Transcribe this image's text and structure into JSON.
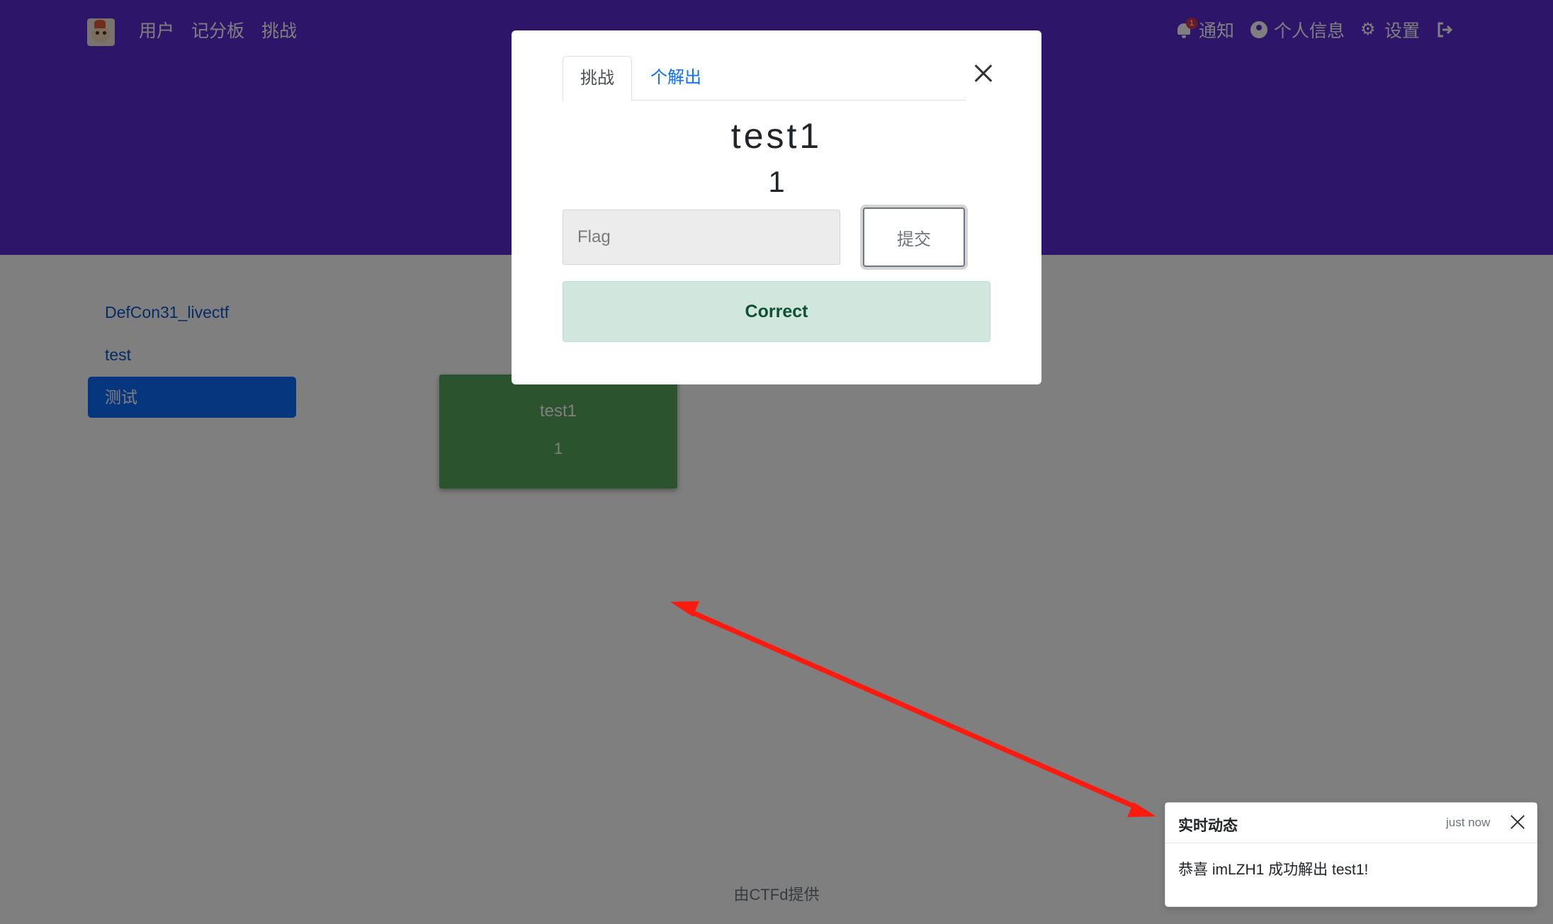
{
  "navbar": {
    "left_links": [
      {
        "label": "用户"
      },
      {
        "label": "记分板"
      },
      {
        "label": "挑战"
      }
    ],
    "notifications": {
      "label": "通知",
      "badge": "1"
    },
    "profile": {
      "label": "个人信息"
    },
    "settings": {
      "label": "设置"
    },
    "icons": {
      "notifications": "bell-icon",
      "profile": "user-circle-icon",
      "settings": "gears-icon",
      "logout": "logout-icon"
    }
  },
  "sidebar": {
    "categories": [
      {
        "label": "DefCon31_livectf"
      },
      {
        "label": "test"
      },
      {
        "label": "测试"
      }
    ],
    "active_index": 2
  },
  "challenge_card": {
    "name": "test1",
    "value": "1"
  },
  "footer": {
    "text": "由CTFd提供"
  },
  "modal": {
    "tabs": [
      {
        "label": "挑战"
      },
      {
        "label": "个解出"
      }
    ],
    "title": "test1",
    "value": "1",
    "flag_placeholder": "Flag",
    "flag_value": "",
    "submit_label": "提交",
    "result_text": "Correct"
  },
  "toast": {
    "title": "实时动态",
    "time": "just now",
    "message": "恭喜 imLZH1 成功解出 test1!"
  },
  "colors": {
    "navbar": "#5b2dd4",
    "solved_card": "#57a85d",
    "active_category": "#0d6efd",
    "correct_bg": "#d1e7dd",
    "correct_text": "#0f5132",
    "annotation_arrow": "#ff1a10"
  }
}
